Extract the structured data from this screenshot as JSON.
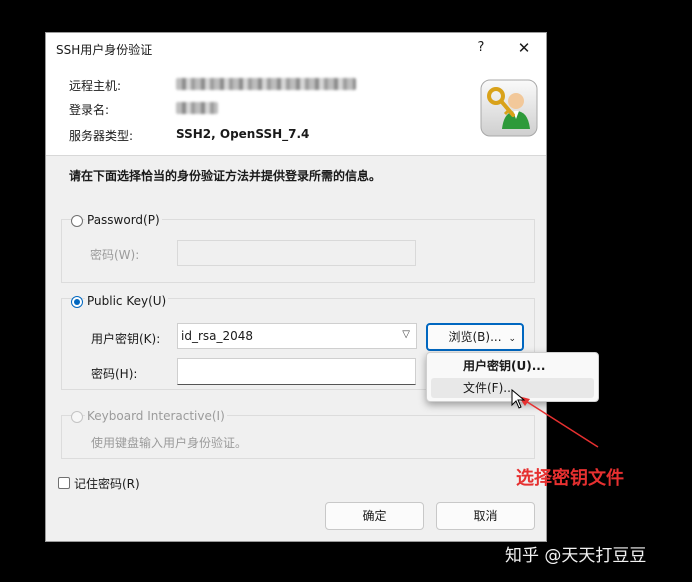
{
  "window": {
    "title": "SSH用户身份验证",
    "help_label": "?",
    "close_label": "✕"
  },
  "info": {
    "remote_host_label": "远程主机:",
    "login_name_label": "登录名:",
    "server_type_label": "服务器类型:",
    "server_type_value": "SSH2, OpenSSH_7.4"
  },
  "instruction": "请在下面选择恰当的身份验证方法并提供登录所需的信息。",
  "password_group": {
    "radio_label": "Password(P)",
    "password_label": "密码(W):"
  },
  "pubkey_group": {
    "radio_label": "Public Key(U)",
    "user_key_label": "用户密钥(K):",
    "user_key_value": "id_rsa_2048",
    "browse_label": "浏览(B)...",
    "passphrase_label": "密码(H):"
  },
  "browse_menu": {
    "items": [
      "用户密钥(U)...",
      "文件(F)..."
    ]
  },
  "keyboard_group": {
    "radio_label": "Keyboard Interactive(I)",
    "description": "使用键盘输入用户身份验证。"
  },
  "remember_label": "记住密码(R)",
  "ok_label": "确定",
  "cancel_label": "取消",
  "annotation": "选择密钥文件",
  "watermark": "知乎 @天天打豆豆",
  "colors": {
    "accent": "#0067c0",
    "annotation": "#e63030"
  }
}
